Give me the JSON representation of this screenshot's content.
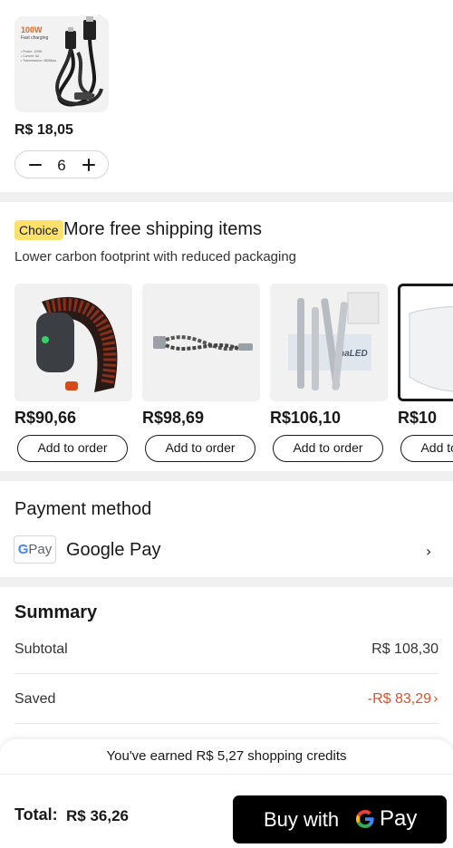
{
  "cart_item": {
    "thumb_title": "100W",
    "thumb_subtitle": "Fast charging",
    "thumb_specs": [
      "• Power: 100W",
      "• Current: 5A",
      "• Transmission: 480Mbps"
    ],
    "price": "R$ 18,05",
    "quantity": "6"
  },
  "free_shipping": {
    "badge": "Choice",
    "title": "More free shipping items",
    "subtitle": "Lower carbon footprint with reduced packaging",
    "products": [
      {
        "price": "R$90,66",
        "button": "Add to order"
      },
      {
        "price": "R$98,69",
        "button": "Add to order"
      },
      {
        "price": "R$106,10",
        "button": "Add to order"
      },
      {
        "price": "R$10",
        "button": "Add to order"
      }
    ]
  },
  "payment": {
    "title": "Payment method",
    "logo_g": "G",
    "logo_pay": "Pay",
    "method": "Google Pay"
  },
  "summary": {
    "title": "Summary",
    "subtotal_label": "Subtotal",
    "subtotal_value": "R$ 108,30",
    "saved_label": "Saved",
    "saved_value": "-R$ 83,29"
  },
  "credits_text": "You've earned R$ 5,27 shopping credits",
  "footer": {
    "total_label": "Total:",
    "total_value": "R$ 36,26",
    "buy_label": "Buy with",
    "buy_pay": "Pay"
  },
  "colors": {
    "accent_red": "#e0502b",
    "choice_yellow": "#fde16a",
    "buy_button": "#000000"
  }
}
